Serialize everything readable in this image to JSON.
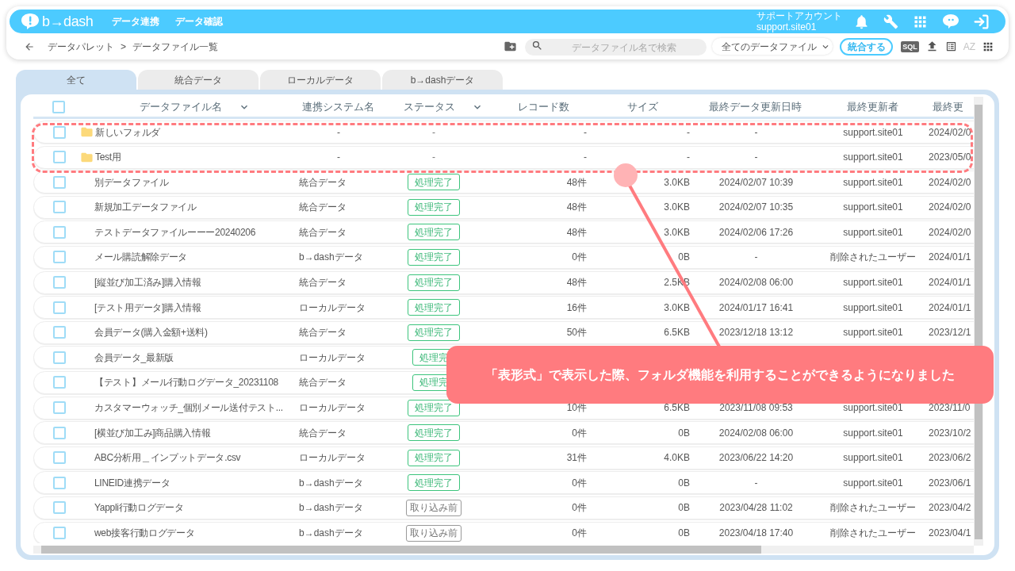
{
  "header": {
    "logo": "b→dash",
    "nav": [
      "データ連携",
      "データ確認"
    ],
    "account": {
      "role": "サポートアカウント",
      "user": "support.site01"
    }
  },
  "toolbar": {
    "breadcrumb": [
      "データパレット",
      "データファイル一覧"
    ],
    "separator": ">",
    "search": {
      "placeholder": "データファイル名で検索"
    },
    "filter": "全てのデータファイル",
    "merge_button": "統合する",
    "sql": "SQL",
    "sort": "AZ"
  },
  "tabs": [
    {
      "label": "全て",
      "selected": true
    },
    {
      "label": "統合データ",
      "selected": false
    },
    {
      "label": "ローカルデータ",
      "selected": false
    },
    {
      "label": "b→dashデータ",
      "selected": false
    }
  ],
  "table": {
    "select_all": {
      "checked": false
    },
    "columns": [
      {
        "label": "データファイル名",
        "sortable": true
      },
      {
        "label": "連携システム名",
        "sortable": false
      },
      {
        "label": "ステータス",
        "sortable": true
      },
      {
        "label": "レコード数",
        "sortable": false
      },
      {
        "label": "サイズ",
        "sortable": false
      },
      {
        "label": "最終データ更新日時",
        "sortable": false
      },
      {
        "label": "最終更新者",
        "sortable": false
      },
      {
        "label": "最終更",
        "sortable": false
      }
    ],
    "rows": [
      {
        "kind": "folder",
        "checked": false,
        "name": "新しいフォルダ",
        "system": "-",
        "status": {
          "text": "-",
          "kind": "none"
        },
        "records": "-",
        "size": "-",
        "updated": "-",
        "updater": "support.site01",
        "last": "2024/02/0"
      },
      {
        "kind": "folder",
        "checked": false,
        "name": "Test用",
        "system": "-",
        "status": {
          "text": "-",
          "kind": "none"
        },
        "records": "-",
        "size": "-",
        "updated": "-",
        "updater": "support.site01",
        "last": "2023/05/0"
      },
      {
        "kind": "file",
        "checked": false,
        "name": "別データファイル",
        "system": "統合データ",
        "status": {
          "text": "処理完了",
          "kind": "done"
        },
        "records": "48件",
        "size": "3.0KB",
        "updated": "2024/02/07 10:39",
        "updater": "support.site01",
        "last": "2024/02/0"
      },
      {
        "kind": "file",
        "checked": false,
        "name": "新規加工データファイル",
        "system": "統合データ",
        "status": {
          "text": "処理完了",
          "kind": "done"
        },
        "records": "48件",
        "size": "3.0KB",
        "updated": "2024/02/07 10:35",
        "updater": "support.site01",
        "last": "2024/02/0"
      },
      {
        "kind": "file",
        "checked": false,
        "name": "テストデータファイルーーー20240206",
        "system": "統合データ",
        "status": {
          "text": "処理完了",
          "kind": "done"
        },
        "records": "48件",
        "size": "3.0KB",
        "updated": "2024/02/06 17:26",
        "updater": "support.site01",
        "last": "2024/02/0"
      },
      {
        "kind": "file",
        "checked": false,
        "name": "メール購読解除データ",
        "system": "b→dashデータ",
        "status": {
          "text": "処理完了",
          "kind": "done"
        },
        "records": "0件",
        "size": "0B",
        "updated": "-",
        "updater": "削除されたユーザー",
        "last": "2024/01/1"
      },
      {
        "kind": "file",
        "checked": false,
        "name": "[縦並び加工済み]購入情報",
        "system": "統合データ",
        "status": {
          "text": "処理完了",
          "kind": "done"
        },
        "records": "48件",
        "size": "2.5KB",
        "updated": "2024/02/08 06:00",
        "updater": "support.site01",
        "last": "2024/01/1"
      },
      {
        "kind": "file",
        "checked": false,
        "name": "[テスト用データ]購入情報",
        "system": "ローカルデータ",
        "status": {
          "text": "処理完了",
          "kind": "done"
        },
        "records": "16件",
        "size": "3.0KB",
        "updated": "2024/01/17 16:41",
        "updater": "support.site01",
        "last": "2024/01/1"
      },
      {
        "kind": "file",
        "checked": false,
        "name": "会員データ(購入金額+送料)",
        "system": "統合データ",
        "status": {
          "text": "処理完了",
          "kind": "done"
        },
        "records": "50件",
        "size": "6.5KB",
        "updated": "2023/12/18 13:12",
        "updater": "support.site01",
        "last": "2023/12/1"
      },
      {
        "kind": "file",
        "checked": false,
        "name": "会員データ_最新版",
        "system": "ローカルデータ",
        "status": {
          "text": "処理完",
          "kind": "done"
        }
      },
      {
        "kind": "file",
        "checked": false,
        "name": "【テスト】メール行動ログデータ_20231108",
        "system": "統合データ",
        "status": {
          "text": "処理完",
          "kind": "done"
        }
      },
      {
        "kind": "file",
        "checked": false,
        "name": "カスタマーウォッチ_個別メール送付テスト...",
        "system": "ローカルデータ",
        "status": {
          "text": "処理完了",
          "kind": "done"
        },
        "records": "10件",
        "size": "6.5KB",
        "updated": "2023/11/08 09:53",
        "updater": "support.site01",
        "last": "2023/11/0"
      },
      {
        "kind": "file",
        "checked": false,
        "name": "[横並び加工み]商品購入情報",
        "system": "統合データ",
        "status": {
          "text": "処理完了",
          "kind": "done"
        },
        "records": "0件",
        "size": "0B",
        "updated": "2024/02/08 06:00",
        "updater": "support.site01",
        "last": "2023/10/2"
      },
      {
        "kind": "file",
        "checked": false,
        "name": "ABC分析用＿インプットデータ.csv",
        "system": "ローカルデータ",
        "status": {
          "text": "処理完了",
          "kind": "done"
        },
        "records": "31件",
        "size": "4.0KB",
        "updated": "2023/06/22 14:20",
        "updater": "support.site01",
        "last": "2023/06/2"
      },
      {
        "kind": "file",
        "checked": false,
        "name": "LINEID連携データ",
        "system": "b→dashデータ",
        "status": {
          "text": "処理完了",
          "kind": "done"
        },
        "records": "0件",
        "size": "0B",
        "updated": "-",
        "updater": "support.site01",
        "last": "2023/06/1"
      },
      {
        "kind": "file",
        "checked": false,
        "name": "Yappli行動ログデータ",
        "system": "b→dashデータ",
        "status": {
          "text": "取り込み前",
          "kind": "pending"
        },
        "records": "0件",
        "size": "0B",
        "updated": "2023/04/28 11:02",
        "updater": "削除されたユーザー",
        "last": "2023/04/2"
      },
      {
        "kind": "file",
        "checked": false,
        "name": "web接客行動ログデータ",
        "system": "b→dashデータ",
        "status": {
          "text": "取り込み前",
          "kind": "pending"
        },
        "records": "0件",
        "size": "0B",
        "updated": "2023/04/18 17:40",
        "updater": "削除されたユーザー",
        "last": "2023/04/1"
      }
    ]
  },
  "annotation": {
    "text": "「表形式」で表示した際、フォルダ機能を利用することができるようになりました"
  }
}
